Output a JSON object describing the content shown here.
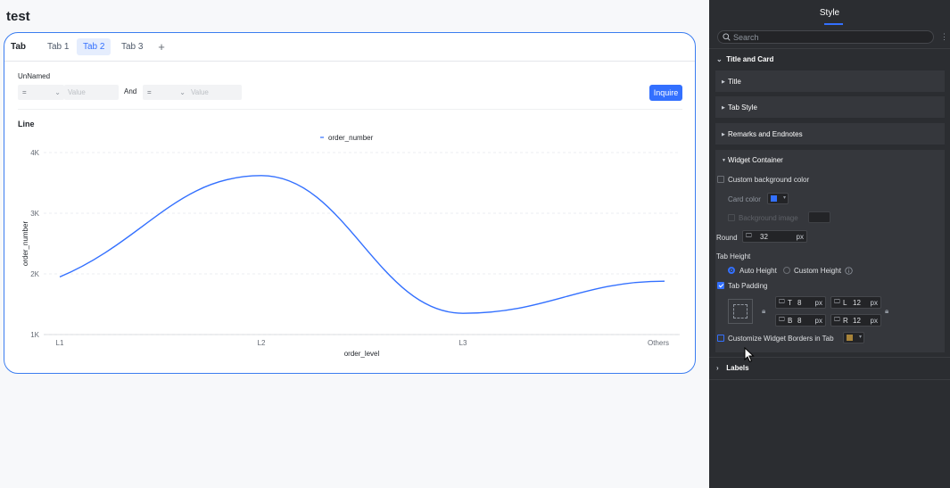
{
  "page": {
    "title": "test"
  },
  "tabs": {
    "title": "Tab",
    "items": [
      {
        "label": "Tab 1",
        "active": false
      },
      {
        "label": "Tab 2",
        "active": true
      },
      {
        "label": "Tab 3",
        "active": false
      }
    ],
    "add_label": "+"
  },
  "filter": {
    "label": "UnNamed",
    "op1": "=",
    "value1_placeholder": "Value",
    "and_label": "And",
    "op2": "=",
    "value2_placeholder": "Value",
    "inquire_label": "Inquire"
  },
  "chart_data": {
    "type": "line",
    "title": "Line",
    "categories": [
      "L1",
      "L2",
      "L3",
      "Others"
    ],
    "series": [
      {
        "name": "order_number",
        "values": [
          1950,
          3620,
          1350,
          1880
        ],
        "color": "#3370ff"
      }
    ],
    "xlabel": "order_level",
    "ylabel": "order_number",
    "ylim": [
      1000,
      4000
    ],
    "yticks": [
      {
        "value": 1000,
        "label": "1K"
      },
      {
        "value": 2000,
        "label": "2K"
      },
      {
        "value": 3000,
        "label": "3K"
      },
      {
        "value": 4000,
        "label": "4K"
      }
    ],
    "smooth": true,
    "grid": true,
    "legend_position": "top-center"
  },
  "panel": {
    "title": "Style",
    "search_placeholder": "Search",
    "group_title": "Title and Card",
    "sections": {
      "title": "Title",
      "tab_style": "Tab Style",
      "remarks": "Remarks and Endnotes",
      "widget_container": "Widget Container"
    },
    "widget": {
      "custom_bg_label": "Custom background color",
      "card_color_label": "Card color",
      "card_color": "#3370ff",
      "bg_image_label": "Background image",
      "round_label": "Round",
      "round_value": "32",
      "round_unit": "px",
      "tab_height_label": "Tab Height",
      "auto_height_label": "Auto Height",
      "custom_height_label": "Custom Height",
      "tab_padding_label": "Tab Padding",
      "pad_t_label": "T",
      "pad_t_value": "8",
      "pad_l_label": "L",
      "pad_l_value": "12",
      "pad_b_label": "B",
      "pad_b_value": "8",
      "pad_r_label": "R",
      "pad_r_value": "12",
      "pad_unit": "px",
      "borders_label": "Customize Widget Borders in Tab",
      "border_color": "#a8843a"
    },
    "labels_section": "Labels"
  },
  "colors": {
    "accent": "#3370ff",
    "card_border": "#3b7df0",
    "panel_bg": "#2b2d31",
    "section_bg": "#35373c"
  }
}
